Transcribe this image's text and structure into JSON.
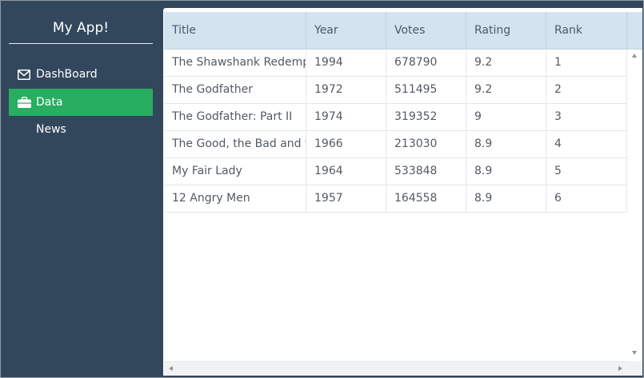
{
  "app": {
    "title": "My App!"
  },
  "sidebar": {
    "items": [
      {
        "label": "DashBoard",
        "icon": "envelope-icon",
        "active": false
      },
      {
        "label": "Data",
        "icon": "briefcase-icon",
        "active": true
      },
      {
        "label": "News",
        "icon": "",
        "active": false
      }
    ]
  },
  "table": {
    "columns": [
      "Title",
      "Year",
      "Votes",
      "Rating",
      "Rank"
    ],
    "rows": [
      [
        "The Shawshank Redemption",
        "1994",
        "678790",
        "9.2",
        "1"
      ],
      [
        "The Godfather",
        "1972",
        "511495",
        "9.2",
        "2"
      ],
      [
        "The Godfather: Part II",
        "1974",
        "319352",
        "9",
        "3"
      ],
      [
        "The Good, the Bad and the Ugly",
        "1966",
        "213030",
        "8.9",
        "4"
      ],
      [
        "My Fair Lady",
        "1964",
        "533848",
        "8.9",
        "5"
      ],
      [
        "12 Angry Men",
        "1957",
        "164558",
        "8.9",
        "6"
      ]
    ]
  },
  "colors": {
    "sidebar_bg": "#33475c",
    "active_item": "#27ae60",
    "header_bg": "#d3e3f0"
  }
}
